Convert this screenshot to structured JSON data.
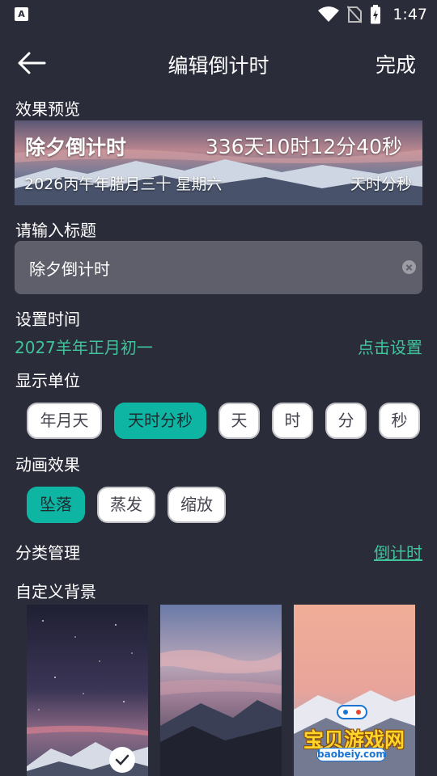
{
  "status_bar": {
    "time": "1:47",
    "icons": [
      "app-notification-icon",
      "wifi-icon",
      "no-sim-icon",
      "battery-charging-icon"
    ]
  },
  "header": {
    "back_icon": "arrow-left-icon",
    "title": "编辑倒计时",
    "done_label": "完成"
  },
  "preview": {
    "section_label": "效果预览",
    "title": "除夕倒计时",
    "countdown": "336天10时12分40秒",
    "date": "2026丙午年腊月三十 星期六",
    "unit": "天时分秒"
  },
  "title_input": {
    "section_label": "请输入标题",
    "value": "除夕倒计时",
    "clear_icon": "clear-circle-icon"
  },
  "time_setting": {
    "section_label": "设置时间",
    "value": "2027羊年正月初一",
    "action_label": "点击设置"
  },
  "display_unit": {
    "section_label": "显示单位",
    "options": [
      "年月天",
      "天时分秒",
      "天",
      "时",
      "分",
      "秒"
    ],
    "selected": "天时分秒"
  },
  "animation": {
    "section_label": "动画效果",
    "options": [
      "坠落",
      "蒸发",
      "缩放"
    ],
    "selected": "坠落"
  },
  "category": {
    "section_label": "分类管理",
    "link_label": "倒计时"
  },
  "custom_background": {
    "section_label": "自定义背景",
    "thumbnails": [
      "starry-night-mountain",
      "sunset-clouds-mountain",
      "pink-sky-snow-mountain"
    ],
    "selected_index": 0,
    "check_icon": "check-icon"
  },
  "watermark": {
    "text": "宝贝游戏网",
    "url": "baobeiy.com"
  },
  "colors": {
    "background": "#2b2c3a",
    "accent_green": "#3fc39a",
    "chip_active": "#0fb5a3",
    "input_bg": "#5e5f6a"
  }
}
